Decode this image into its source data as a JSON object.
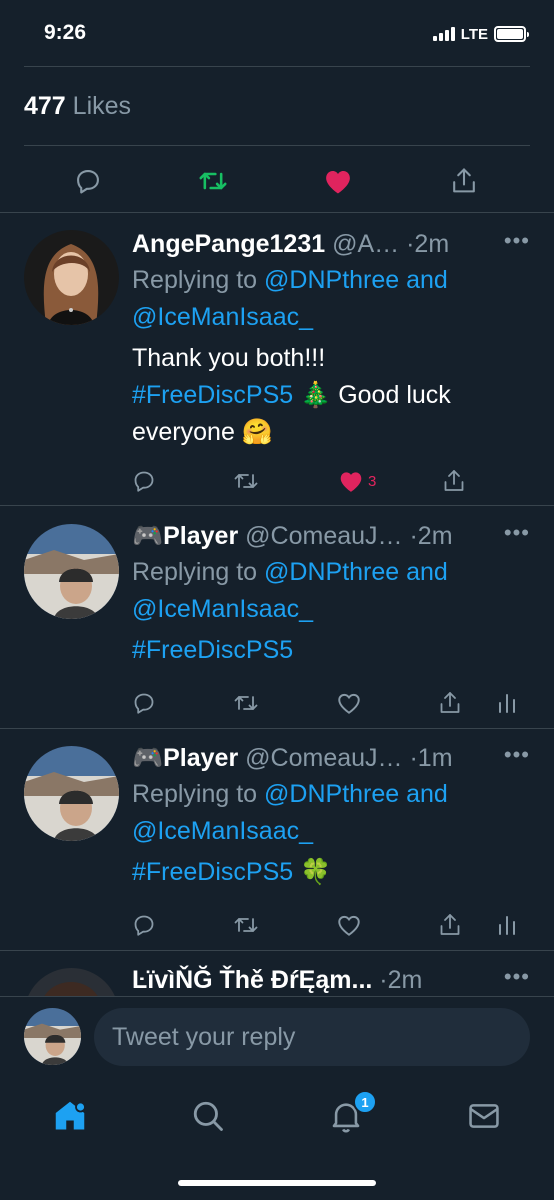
{
  "status": {
    "time": "9:26",
    "network": "LTE"
  },
  "likes": {
    "count": "477",
    "label": "Likes"
  },
  "tweets": [
    {
      "name": "AngePange1231",
      "handle": "@A…",
      "time": "·2m",
      "replying_prefix": "Replying to ",
      "replying_first": "@DNPthree and",
      "replying_second": "@IceManIsaac_",
      "line1": "Thank you both!!!",
      "hashtag": "#FreeDiscPS5",
      "emoji1": "🎄",
      "line2_tail": " Good luck",
      "line3": "everyone 🤗",
      "like_count": "3"
    },
    {
      "name": "🎮Player",
      "handle": "@ComeauJ…",
      "time": "·2m",
      "replying_prefix": "Replying to ",
      "replying_first": "@DNPthree and",
      "replying_second": "@IceManIsaac_",
      "hashtag": "#FreeDiscPS5",
      "emoji": ""
    },
    {
      "name": "🎮Player",
      "handle": "@ComeauJ…",
      "time": "·1m",
      "replying_prefix": "Replying to ",
      "replying_first": "@DNPthree and",
      "replying_second": "@IceManIsaac_",
      "hashtag": "#FreeDiscPS5",
      "emoji": "🍀"
    },
    {
      "name": "ĿïvìŇĞ Ťhě ĐŕĘąm...",
      "time": "·2m"
    }
  ],
  "reply": {
    "placeholder": "Tweet your reply"
  },
  "tabs": {
    "notifications_badge": "1"
  },
  "colors": {
    "background": "#15202b",
    "accent": "#1da1f2",
    "like": "#e0245e",
    "retweet": "#17bf63",
    "muted": "#8899a6"
  }
}
